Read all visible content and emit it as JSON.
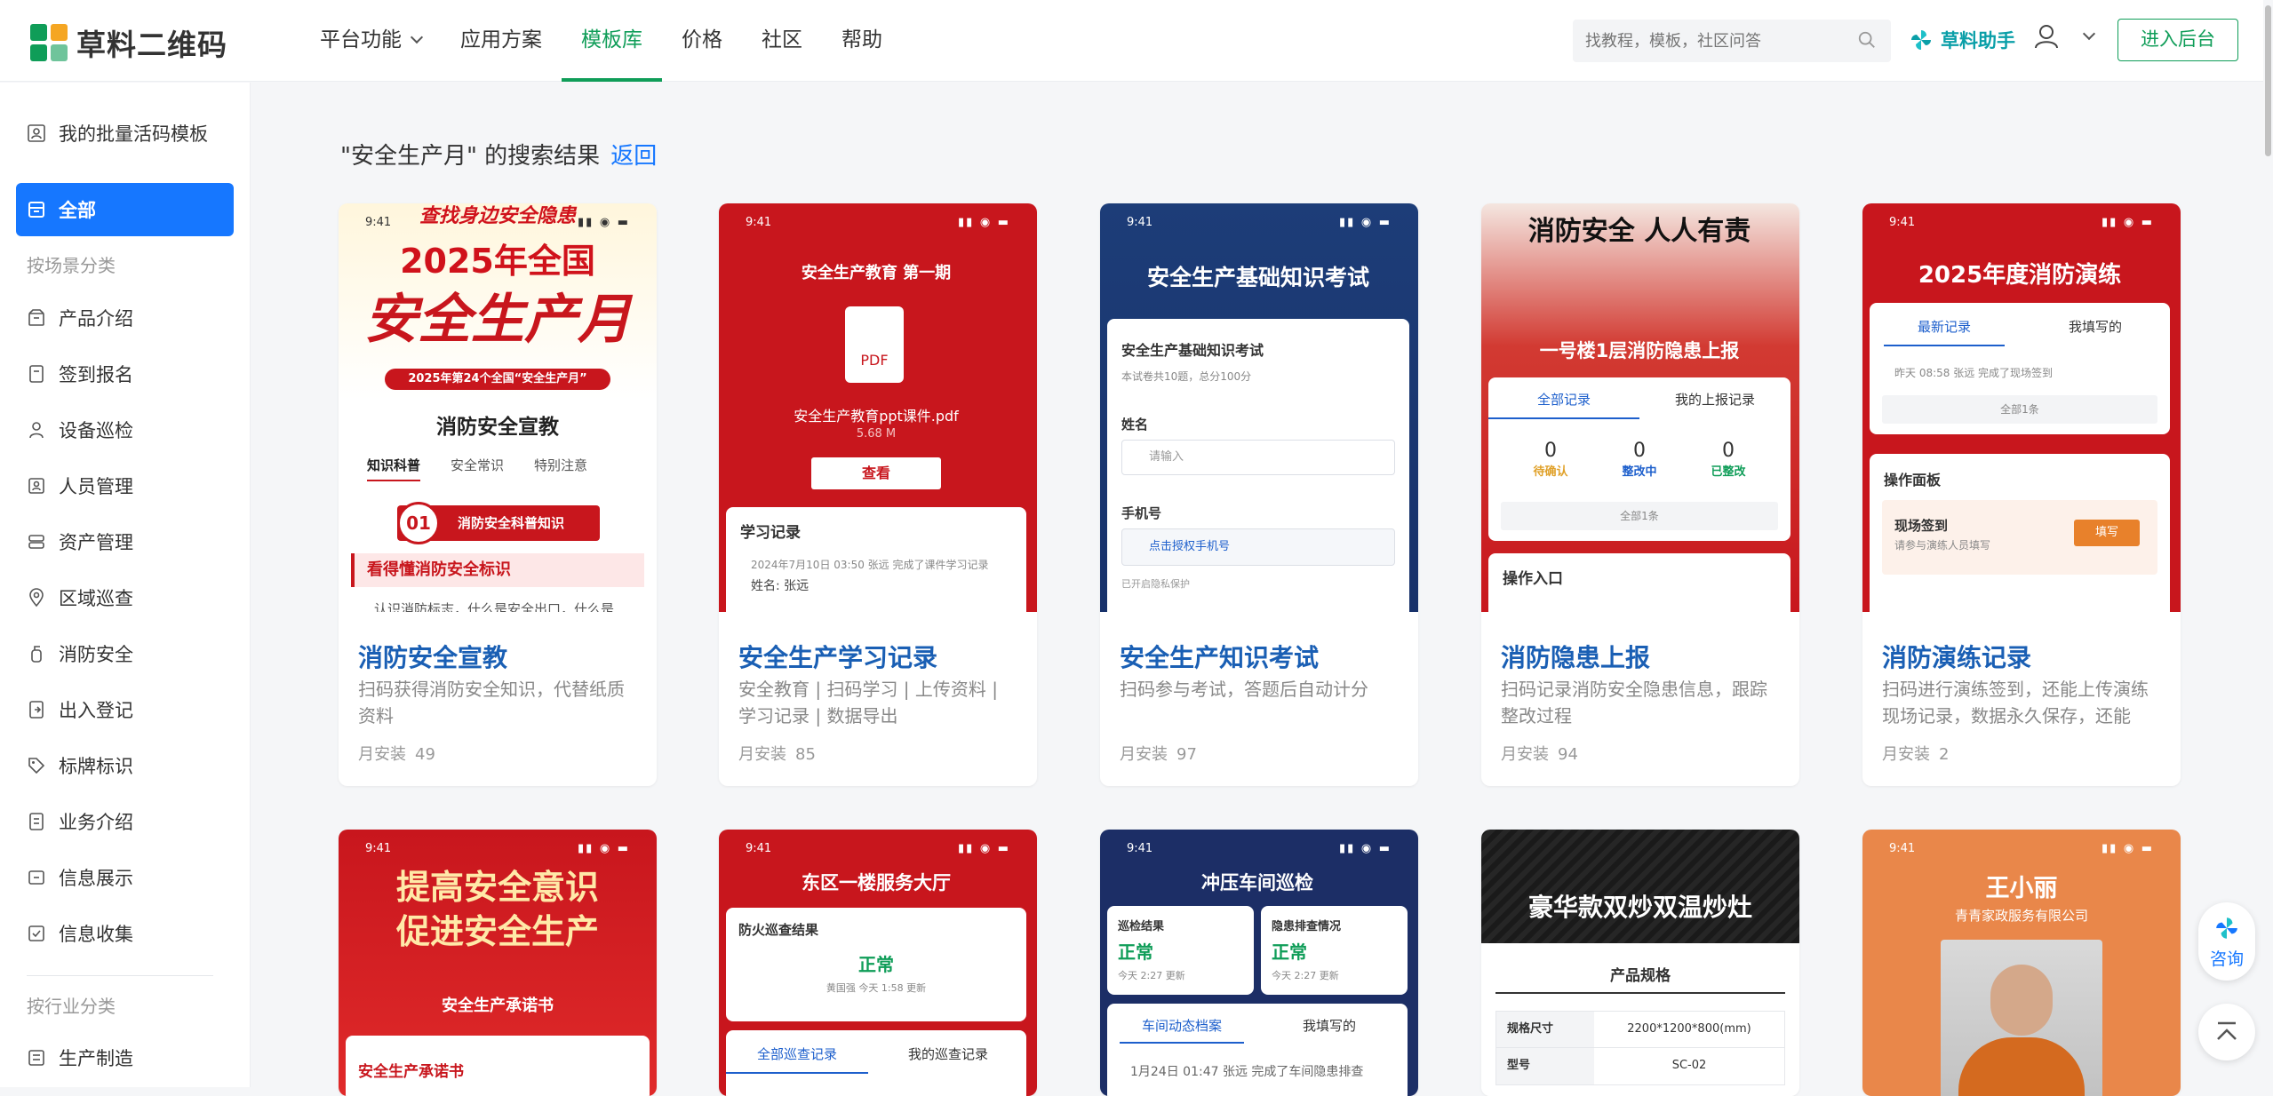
{
  "brand": {
    "name": "草料二维码",
    "colors": {
      "green": "#0f9d58",
      "blue": "#1677ff",
      "red": "#c8161d"
    }
  },
  "nav": {
    "items": [
      {
        "label": "平台功能",
        "dropdown": true
      },
      {
        "label": "应用方案"
      },
      {
        "label": "模板库",
        "active": true
      },
      {
        "label": "价格"
      },
      {
        "label": "社区"
      },
      {
        "label": "帮助"
      }
    ]
  },
  "header": {
    "search_placeholder": "找教程，模板，社区问答",
    "assistant_label": "草料助手",
    "enter_button": "进入后台"
  },
  "sidebar": {
    "top_item": "我的批量活码模板",
    "all_label": "全部",
    "category_scene": "按场景分类",
    "scene_items": [
      "产品介绍",
      "签到报名",
      "设备巡检",
      "人员管理",
      "资产管理",
      "区域巡查",
      "消防安全",
      "出入登记",
      "标牌标识",
      "业务介绍",
      "信息展示",
      "信息收集"
    ],
    "category_industry": "按行业分类",
    "industry_items": [
      "生产制造"
    ]
  },
  "search_result": {
    "query_text": "\"安全生产月\" 的搜索结果",
    "back_label": "返回"
  },
  "cards": [
    {
      "title": "消防安全宣教",
      "desc": "扫码获得消防安全知识，代替纸质资料",
      "stat_label": "月安装",
      "stat_value": "49"
    },
    {
      "title": "安全生产学习记录",
      "desc": "安全教育 | 扫码学习 | 上传资料 | 学习记录 | 数据导出",
      "stat_label": "月安装",
      "stat_value": "85"
    },
    {
      "title": "安全生产知识考试",
      "desc": "扫码参与考试，答题后自动计分",
      "stat_label": "月安装",
      "stat_value": "97"
    },
    {
      "title": "消防隐患上报",
      "desc": "扫码记录消防安全隐患信息，跟踪整改过程",
      "stat_label": "月安装",
      "stat_value": "94"
    },
    {
      "title": "消防演练记录",
      "desc": "扫码进行演练签到，还能上传演练现场记录，数据永久保存，还能统...",
      "stat_label": "月安装",
      "stat_value": "2"
    }
  ],
  "thumbs": {
    "time": "9:41",
    "t1": {
      "top": "查找身边安全隐患",
      "year": "2025年全国",
      "big": "安全生产月",
      "ribbon": "2025年第24个全国“安全生产月”",
      "heading": "消防安全宣教",
      "tabs": [
        "知识科普",
        "安全常识",
        "特别注意"
      ],
      "num": "01",
      "num_label": "消防安全科普知识",
      "section": "看得懂消防安全标识",
      "cut": "认识消防标志，什么是安全出口，什么是"
    },
    "t2": {
      "heading": "安全生产教育 第一期",
      "pdf": "PDF",
      "file": "安全生产教育ppt课件.pdf",
      "size": "5.68 M",
      "button": "查看",
      "log_title": "学习记录",
      "log_line": "2024年7月10日 03:50  张远  完成了课件学习记录",
      "name_label": "姓名:",
      "name_value": "张远"
    },
    "t3": {
      "heading": "安全生产基础知识考试",
      "form_title": "安全生产基础知识考试",
      "form_sub": "本试卷共10题，总分100分",
      "f1": "姓名",
      "p1": "请输入",
      "f2": "手机号",
      "p2": "点击授权手机号",
      "privacy": "已开启隐私保护"
    },
    "t4": {
      "banner": "消防安全 人人有责",
      "heading": "一号楼1层消防隐患上报",
      "tabs": [
        "全部记录",
        "我的上报记录"
      ],
      "stats": [
        {
          "v": "0",
          "l": "待确认"
        },
        {
          "v": "0",
          "l": "整改中"
        },
        {
          "v": "0",
          "l": "已整改"
        }
      ],
      "all": "全部1条",
      "entry": "操作入口"
    },
    "t5": {
      "heading": "2025年度消防演练",
      "tabs": [
        "最新记录",
        "我填写的"
      ],
      "rec": "昨天 08:58  张远  完成了现场签到",
      "all": "全部1条",
      "panel": "操作面板",
      "item": "现场签到",
      "item_sub": "请参与演练人员填写",
      "btn": "填写"
    },
    "t6": {
      "l1": "提高安全意识",
      "l2": "促进安全生产",
      "sub": "安全生产承诺书",
      "box": "安全生产承诺书"
    },
    "t7": {
      "heading": "东区一楼服务大厅",
      "box": "防火巡查结果",
      "status": "正常",
      "meta": "黄国强  今天 1:58 更新",
      "tabs": [
        "全部巡查记录",
        "我的巡查记录"
      ]
    },
    "t8": {
      "heading": "冲压车间巡检",
      "c1": "巡检结果",
      "c2": "隐患排查情况",
      "s": "正常",
      "m": "今天 2:27 更新",
      "tabs": [
        "车间动态档案",
        "我填写的"
      ],
      "rec": "1月24日 01:47  张远  完成了车间隐患排查"
    },
    "t9": {
      "heading": "豪华款双炒双温炒灶",
      "spec": "产品规格",
      "rows": [
        {
          "k": "规格尺寸",
          "v": "2200*1200*800(mm)"
        },
        {
          "k": "型号",
          "v": "SC-02"
        }
      ]
    },
    "t10": {
      "name": "王小丽",
      "company": "青青家政服务有限公司"
    }
  },
  "float": {
    "consult": "咨询"
  }
}
